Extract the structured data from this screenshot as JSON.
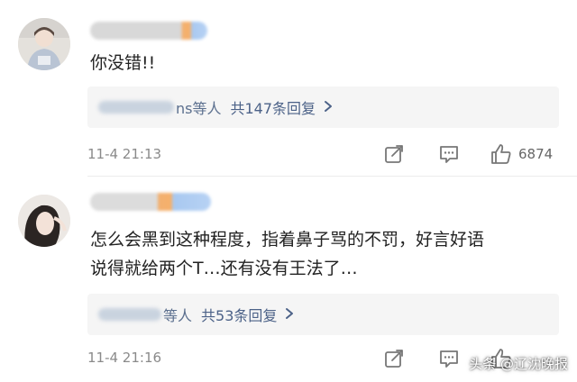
{
  "comments": [
    {
      "text": "你没错!!",
      "reply_prefix": "",
      "reply_suffix": "ns等人",
      "reply_count": "共147条回复",
      "timestamp": "11-4 21:13",
      "likes": "6874"
    },
    {
      "text_lines": [
        "怎么会黑到这种程度，指着鼻子骂的不罚，好言好语",
        "说得就给两个T…还有没有王法了…"
      ],
      "reply_suffix": "等人",
      "reply_count": "共53条回复",
      "timestamp": "11-4 21:16",
      "likes": ""
    }
  ],
  "icons": {
    "share": "share-icon",
    "comment": "comment-icon",
    "like": "thumbs-up-icon",
    "chevron": "chevron-right-icon"
  },
  "watermark": "头条 @辽沈晚报",
  "colors": {
    "link": "#4c6288",
    "meta": "#8a8a8a",
    "reply_bg": "#f5f5f5"
  }
}
